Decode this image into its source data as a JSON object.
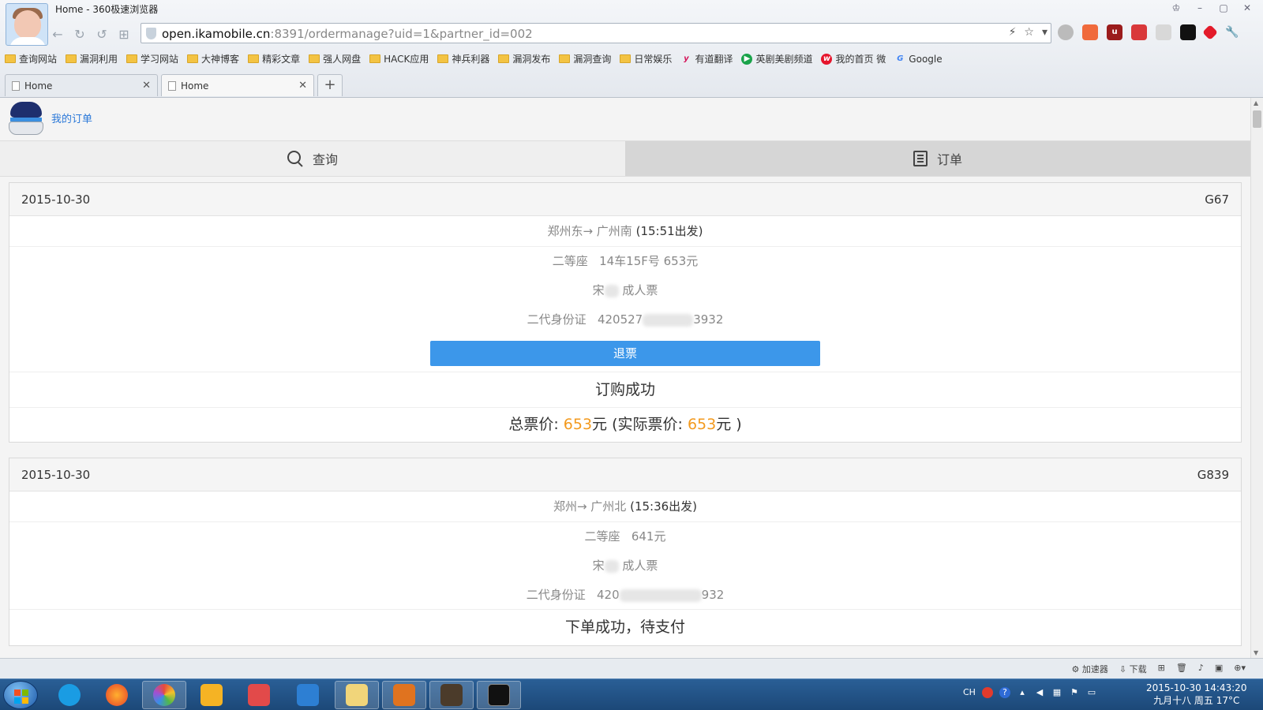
{
  "window": {
    "title": "Home - 360极速浏览器"
  },
  "address_bar": {
    "host": "open.ikamobile.cn",
    "rest": ":8391/ordermanage?uid=1&partner_id=002"
  },
  "bookmarks": [
    "查询网站",
    "漏洞利用",
    "学习网站",
    "大神博客",
    "精彩文章",
    "强人网盘",
    "HACK应用",
    "神兵利器",
    "漏洞发布",
    "漏洞查询",
    "日常娱乐",
    "有道翻译",
    "英剧美剧频道",
    "我的首页 微",
    "Google"
  ],
  "tabs": [
    {
      "label": "Home"
    },
    {
      "label": "Home"
    }
  ],
  "site": {
    "link": "我的订单"
  },
  "nav": {
    "query": "查询",
    "orders": "订单"
  },
  "orders": [
    {
      "date": "2015-10-30",
      "train": "G67",
      "route": "郑州东→ 广州南",
      "depart": "(15:51出发)",
      "seat": "二等座",
      "seat_detail": "14车15F号 653元",
      "passenger": "宋",
      "ticket_type": "成人票",
      "id_label": "二代身份证",
      "id_prefix": "420527",
      "id_suffix": "3932",
      "refund_label": "退票",
      "status": "订购成功",
      "price_label": "总票价:",
      "price_total": "653",
      "price_unit": "元",
      "actual_label": "(实际票价:",
      "price_actual": "653",
      "price_close": "元 )"
    },
    {
      "date": "2015-10-30",
      "train": "G839",
      "route": "郑州→ 广州北",
      "depart": "(15:36出发)",
      "seat": "二等座",
      "seat_detail": "641元",
      "passenger": "宋",
      "ticket_type": "成人票",
      "id_label": "二代身份证",
      "id_prefix": "420",
      "id_suffix": "932",
      "status": "下单成功，待支付"
    }
  ],
  "statusbar": {
    "accelerator": "加速器",
    "download": "下载"
  },
  "taskbar": {
    "lang": "CH",
    "clock_line1": "2015-10-30  14:43:20",
    "clock_line2": "九月十八 周五 17°C"
  }
}
